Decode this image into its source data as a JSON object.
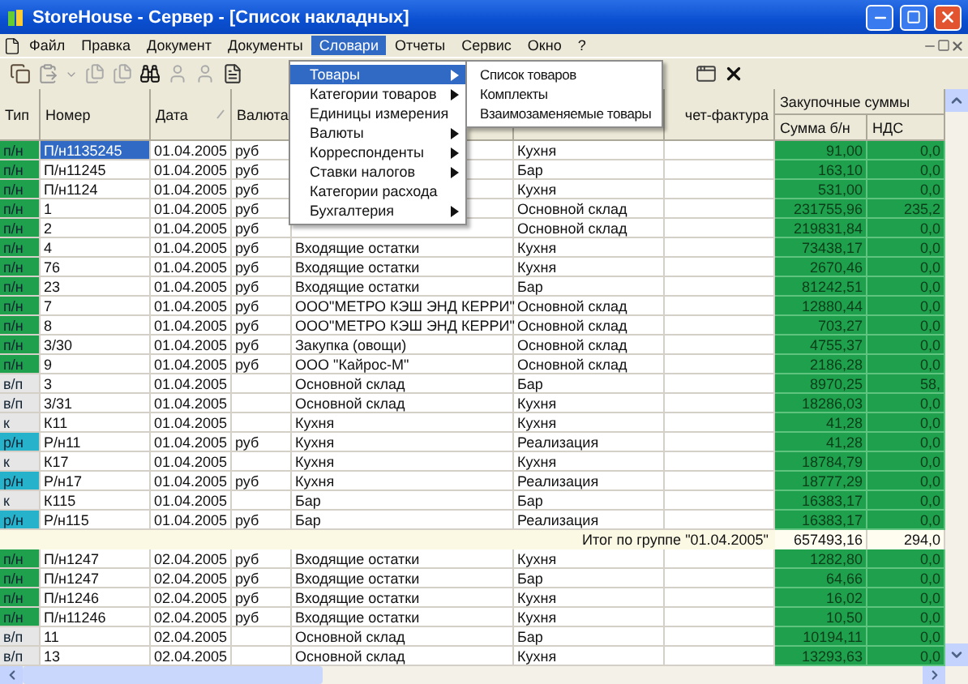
{
  "window": {
    "title": "StoreHouse - Сервер - [Список накладных]"
  },
  "menu": [
    {
      "label": "Файл",
      "selected": false
    },
    {
      "label": "Правка",
      "selected": false
    },
    {
      "label": "Документ",
      "selected": false
    },
    {
      "label": "Документы",
      "selected": false
    },
    {
      "label": "Словари",
      "selected": true
    },
    {
      "label": "Отчеты",
      "selected": false
    },
    {
      "label": "Сервис",
      "selected": false
    },
    {
      "label": "Окно",
      "selected": false
    },
    {
      "label": "?",
      "selected": false
    }
  ],
  "dropdown": [
    {
      "label": "Товары",
      "selected": true,
      "submenu": true
    },
    {
      "label": "Категории товаров",
      "selected": false,
      "submenu": true
    },
    {
      "label": "Единицы измерения",
      "selected": false,
      "submenu": false
    },
    {
      "label": "Валюты",
      "selected": false,
      "submenu": true
    },
    {
      "label": "Корреспонденты",
      "selected": false,
      "submenu": true
    },
    {
      "label": "Ставки налогов",
      "selected": false,
      "submenu": true
    },
    {
      "label": "Категории расхода",
      "selected": false,
      "submenu": false
    },
    {
      "label": "Бухгалтерия",
      "selected": false,
      "submenu": true
    }
  ],
  "submenu": [
    "Список товаров",
    "Комплекты",
    "Взаимозаменяемые товары"
  ],
  "table": {
    "columns": [
      "Тип",
      "Номер",
      "Дата",
      "Валюта"
    ],
    "column_7": "чет-фактура",
    "group_header": "Закупочные суммы",
    "sub_columns": [
      "Сумма б/н",
      "НДС"
    ],
    "rows": [
      {
        "kind": "item",
        "selected": true,
        "type": "п/н",
        "color": "#1fa04d",
        "number": "П/н1135245",
        "date": "01.04.2005",
        "currency": "руб",
        "column_6": "Кухня",
        "sum": "91,00",
        "vat": "0,0"
      },
      {
        "kind": "item",
        "selected": false,
        "type": "п/н",
        "color": "#1fa04d",
        "number": "П/н11245",
        "date": "01.04.2005",
        "currency": "руб",
        "column_6": "Бар",
        "sum": "163,10",
        "vat": "0,0"
      },
      {
        "kind": "item",
        "selected": false,
        "type": "п/н",
        "color": "#1fa04d",
        "number": "П/н1124",
        "date": "01.04.2005",
        "currency": "руб",
        "column_6": "Кухня",
        "sum": "531,00",
        "vat": "0,0"
      },
      {
        "kind": "item",
        "selected": false,
        "type": "п/н",
        "color": "#1fa04d",
        "number": "1",
        "date": "01.04.2005",
        "currency": "руб",
        "column_6": "Основной склад",
        "sum": "231755,96",
        "vat": "235,2"
      },
      {
        "kind": "item",
        "selected": false,
        "type": "п/н",
        "color": "#1fa04d",
        "number": "2",
        "date": "01.04.2005",
        "currency": "руб",
        "column_6": "Основной склад",
        "sum": "219831,84",
        "vat": "0,0"
      },
      {
        "kind": "item",
        "selected": false,
        "type": "п/н",
        "color": "#1fa04d",
        "number": "4",
        "date": "01.04.2005",
        "currency": "руб",
        "column_5": "Входящие остатки",
        "column_6": "Кухня",
        "sum": "73438,17",
        "vat": "0,0"
      },
      {
        "kind": "item",
        "selected": false,
        "type": "п/н",
        "color": "#1fa04d",
        "number": "76",
        "date": "01.04.2005",
        "currency": "руб",
        "column_5": "Входящие остатки",
        "column_6": "Кухня",
        "sum": "2670,46",
        "vat": "0,0"
      },
      {
        "kind": "item",
        "selected": false,
        "type": "п/н",
        "color": "#1fa04d",
        "number": "23",
        "date": "01.04.2005",
        "currency": "руб",
        "column_5": "Входящие остатки",
        "column_6": "Бар",
        "sum": "81242,51",
        "vat": "0,0"
      },
      {
        "kind": "item",
        "selected": false,
        "type": "п/н",
        "color": "#1fa04d",
        "number": "7",
        "date": "01.04.2005",
        "currency": "руб",
        "column_5": "ООО\"МЕТРО КЭШ ЭНД КЕРРИ\"",
        "column_6": "Основной склад",
        "sum": "12880,44",
        "vat": "0,0"
      },
      {
        "kind": "item",
        "selected": false,
        "type": "п/н",
        "color": "#1fa04d",
        "number": "8",
        "date": "01.04.2005",
        "currency": "руб",
        "column_5": "ООО\"МЕТРО КЭШ ЭНД КЕРРИ\"",
        "column_6": "Основной склад",
        "sum": "703,27",
        "vat": "0,0"
      },
      {
        "kind": "item",
        "selected": false,
        "type": "п/н",
        "color": "#1fa04d",
        "number": "3/30",
        "date": "01.04.2005",
        "currency": "руб",
        "column_5": "Закупка (овощи)",
        "column_6": "Основной склад",
        "sum": "4755,37",
        "vat": "0,0"
      },
      {
        "kind": "item",
        "selected": false,
        "type": "п/н",
        "color": "#1fa04d",
        "number": "9",
        "date": "01.04.2005",
        "currency": "руб",
        "column_5": "ООО \"Кайрос-М\"",
        "column_6": "Основной склад",
        "sum": "2186,28",
        "vat": "0,0"
      },
      {
        "kind": "item",
        "selected": false,
        "type": "в/п",
        "color": "#e6e6e6",
        "number": "3",
        "date": "01.04.2005",
        "column_5": "Основной склад",
        "column_6": "Бар",
        "sum": "8970,25",
        "vat": "58,"
      },
      {
        "kind": "item",
        "selected": false,
        "type": "в/п",
        "color": "#e6e6e6",
        "number": "3/31",
        "date": "01.04.2005",
        "column_5": "Основной склад",
        "column_6": "Кухня",
        "sum": "18286,03",
        "vat": "0,0"
      },
      {
        "kind": "item",
        "selected": false,
        "type": "к",
        "color": "#e6e6e6",
        "number": "К11",
        "date": "01.04.2005",
        "column_5": "Кухня",
        "column_6": "Кухня",
        "sum": "41,28",
        "vat": "0,0"
      },
      {
        "kind": "item",
        "selected": false,
        "type": "р/н",
        "color": "#27b2cc",
        "number": "Р/н11",
        "date": "01.04.2005",
        "currency": "руб",
        "column_5": "Кухня",
        "column_6": "Реализация",
        "sum": "41,28",
        "vat": "0,0"
      },
      {
        "kind": "item",
        "selected": false,
        "type": "к",
        "color": "#e6e6e6",
        "number": "К17",
        "date": "01.04.2005",
        "column_5": "Кухня",
        "column_6": "Кухня",
        "sum": "18784,79",
        "vat": "0,0"
      },
      {
        "kind": "item",
        "selected": false,
        "type": "р/н",
        "color": "#27b2cc",
        "number": "Р/н17",
        "date": "01.04.2005",
        "currency": "руб",
        "column_5": "Кухня",
        "column_6": "Реализация",
        "sum": "18777,29",
        "vat": "0,0"
      },
      {
        "kind": "item",
        "selected": false,
        "type": "к",
        "color": "#e6e6e6",
        "number": "К115",
        "date": "01.04.2005",
        "column_5": "Бар",
        "column_6": "Бар",
        "sum": "16383,17",
        "vat": "0,0"
      },
      {
        "kind": "item",
        "selected": false,
        "type": "р/н",
        "color": "#27b2cc",
        "number": "Р/н115",
        "date": "01.04.2005",
        "currency": "руб",
        "column_5": "Бар",
        "column_6": "Реализация",
        "sum": "16383,17",
        "vat": "0,0"
      },
      {
        "kind": "total",
        "label": "Итог по группе \"01.04.2005\"",
        "sum": "657493,16",
        "vat": "294,0"
      },
      {
        "kind": "item",
        "selected": false,
        "type": "п/н",
        "color": "#1fa04d",
        "number": "П/н1247",
        "date": "02.04.2005",
        "currency": "руб",
        "column_5": "Входящие остатки",
        "column_6": "Кухня",
        "sum": "1282,80",
        "vat": "0,0"
      },
      {
        "kind": "item",
        "selected": false,
        "type": "п/н",
        "color": "#1fa04d",
        "number": "П/н1247",
        "date": "02.04.2005",
        "currency": "руб",
        "column_5": "Входящие остатки",
        "column_6": "Бар",
        "sum": "64,66",
        "vat": "0,0"
      },
      {
        "kind": "item",
        "selected": false,
        "type": "п/н",
        "color": "#1fa04d",
        "number": "П/н1246",
        "date": "02.04.2005",
        "currency": "руб",
        "column_5": "Входящие остатки",
        "column_6": "Кухня",
        "sum": "16,02",
        "vat": "0,0"
      },
      {
        "kind": "item",
        "selected": false,
        "type": "п/н",
        "color": "#1fa04d",
        "number": "П/н11246",
        "date": "02.04.2005",
        "currency": "руб",
        "column_5": "Входящие остатки",
        "column_6": "Кухня",
        "sum": "10,50",
        "vat": "0,0"
      },
      {
        "kind": "item",
        "selected": false,
        "type": "в/п",
        "color": "#e6e6e6",
        "number": "11",
        "date": "02.04.2005",
        "column_5": "Основной склад",
        "column_6": "Бар",
        "sum": "10194,11",
        "vat": "0,0"
      },
      {
        "kind": "item",
        "selected": false,
        "type": "в/п",
        "color": "#e6e6e6",
        "number": "13",
        "date": "02.04.2005",
        "column_5": "Основной склад",
        "column_6": "Кухня",
        "sum": "13293,63",
        "vat": "0,0"
      }
    ]
  }
}
